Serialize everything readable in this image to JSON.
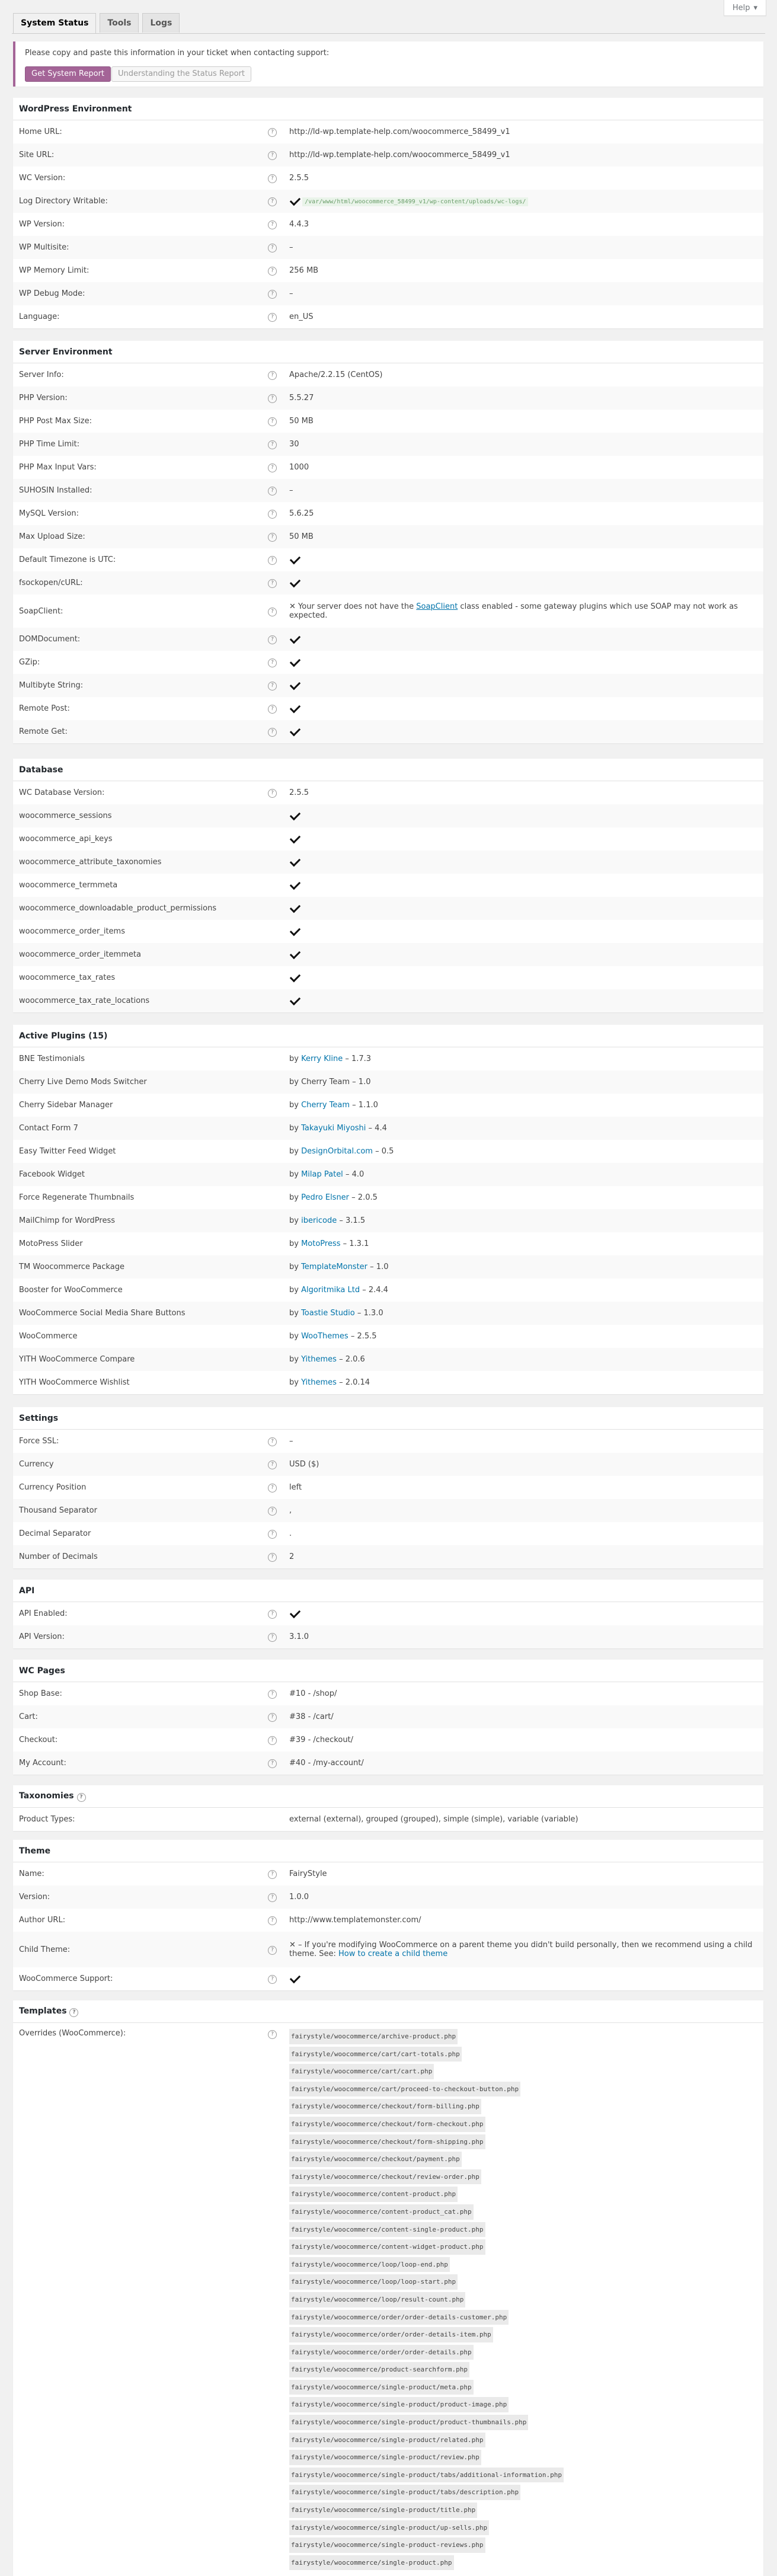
{
  "help_label": "Help",
  "tabs": [
    {
      "label": "System Status"
    },
    {
      "label": "Tools"
    },
    {
      "label": "Logs"
    }
  ],
  "notice": {
    "text": "Please copy and paste this information in your ticket when contacting support:",
    "get_report": "Get System Report",
    "understanding": "Understanding the Status Report"
  },
  "wp_env": {
    "title": "WordPress Environment",
    "rows": [
      {
        "label": "Home URL:",
        "value": "http://ld-wp.template-help.com/woocommerce_58499_v1"
      },
      {
        "label": "Site URL:",
        "value": "http://ld-wp.template-help.com/woocommerce_58499_v1"
      },
      {
        "label": "WC Version:",
        "value": "2.5.5"
      },
      {
        "label": "Log Directory Writable:",
        "value": "/var/www/html/woocommerce_58499_v1/wp-content/uploads/wc-logs/"
      },
      {
        "label": "WP Version:",
        "value": "4.4.3"
      },
      {
        "label": "WP Multisite:",
        "value": "–"
      },
      {
        "label": "WP Memory Limit:",
        "value": "256 MB"
      },
      {
        "label": "WP Debug Mode:",
        "value": "–"
      },
      {
        "label": "Language:",
        "value": "en_US"
      }
    ]
  },
  "server_env": {
    "title": "Server Environment",
    "rows": [
      {
        "label": "Server Info:",
        "value": "Apache/2.2.15 (CentOS)"
      },
      {
        "label": "PHP Version:",
        "value": "5.5.27"
      },
      {
        "label": "PHP Post Max Size:",
        "value": "50 MB"
      },
      {
        "label": "PHP Time Limit:",
        "value": "30"
      },
      {
        "label": "PHP Max Input Vars:",
        "value": "1000"
      },
      {
        "label": "SUHOSIN Installed:",
        "value": "–"
      },
      {
        "label": "MySQL Version:",
        "value": "5.6.25"
      },
      {
        "label": "Max Upload Size:",
        "value": "50 MB"
      },
      {
        "label": "Default Timezone is UTC:",
        "value": ""
      },
      {
        "label": "fsockopen/cURL:",
        "value": ""
      },
      {
        "label": "SoapClient:",
        "value": "✕ Your server does not have the ",
        "link": "SoapClient",
        "value2": " class enabled - some gateway plugins which use SOAP may not work as expected."
      },
      {
        "label": "DOMDocument:",
        "value": ""
      },
      {
        "label": "GZip:",
        "value": ""
      },
      {
        "label": "Multibyte String:",
        "value": ""
      },
      {
        "label": "Remote Post:",
        "value": ""
      },
      {
        "label": "Remote Get:",
        "value": ""
      }
    ]
  },
  "database": {
    "title": "Database",
    "rows": [
      {
        "label": "WC Database Version:",
        "value": "2.5.5"
      },
      {
        "label": "woocommerce_sessions"
      },
      {
        "label": "woocommerce_api_keys"
      },
      {
        "label": "woocommerce_attribute_taxonomies"
      },
      {
        "label": "woocommerce_termmeta"
      },
      {
        "label": "woocommerce_downloadable_product_permissions"
      },
      {
        "label": "woocommerce_order_items"
      },
      {
        "label": "woocommerce_order_itemmeta"
      },
      {
        "label": "woocommerce_tax_rates"
      },
      {
        "label": "woocommerce_tax_rate_locations"
      }
    ]
  },
  "plugins": {
    "title": "Active Plugins (15)",
    "rows": [
      {
        "name": "BNE Testimonials",
        "by": "by ",
        "author": "Kerry Kline",
        "ver": " – 1.7.3",
        "name_link": true,
        "author_link": true
      },
      {
        "name": "Cherry Live Demo Mods Switcher",
        "by": "by Cherry Team – 1.0",
        "author": "",
        "ver": "",
        "name_link": false,
        "author_link": false
      },
      {
        "name": "Cherry Sidebar Manager",
        "by": "by ",
        "author": "Cherry Team",
        "ver": " – 1.1.0",
        "name_link": true,
        "author_link": true
      },
      {
        "name": "Contact Form 7",
        "by": "by ",
        "author": "Takayuki Miyoshi",
        "ver": " – 4.4",
        "name_link": true,
        "author_link": true
      },
      {
        "name": "Easy Twitter Feed Widget",
        "by": "by ",
        "author": "DesignOrbital.com",
        "ver": " – 0.5",
        "name_link": true,
        "author_link": true
      },
      {
        "name": "Facebook Widget",
        "by": "by ",
        "author": "Milap Patel",
        "ver": " – 4.0",
        "name_link": true,
        "author_link": true
      },
      {
        "name": "Force Regenerate Thumbnails",
        "by": "by ",
        "author": "Pedro Elsner",
        "ver": " – 2.0.5",
        "name_link": true,
        "author_link": true
      },
      {
        "name": "MailChimp for WordPress",
        "by": "by ",
        "author": "ibericode",
        "ver": " – 3.1.5",
        "name_link": true,
        "author_link": true
      },
      {
        "name": "MotoPress Slider",
        "by": "by ",
        "author": "MotoPress",
        "ver": " – 1.3.1",
        "name_link": true,
        "author_link": true
      },
      {
        "name": "TM Woocommerce Package",
        "by": "by ",
        "author": "TemplateMonster",
        "ver": " – 1.0",
        "name_link": false,
        "author_link": true
      },
      {
        "name": "Booster for WooCommerce",
        "by": "by ",
        "author": "Algoritmika Ltd",
        "ver": " – 2.4.4",
        "name_link": true,
        "author_link": true
      },
      {
        "name": "WooCommerce Social Media Share Buttons",
        "by": "by ",
        "author": "Toastie Studio",
        "ver": " – 1.3.0",
        "name_link": true,
        "author_link": true
      },
      {
        "name": "WooCommerce",
        "by": "by ",
        "author": "WooThemes",
        "ver": " – 2.5.5",
        "name_link": true,
        "author_link": true
      },
      {
        "name": "YITH WooCommerce Compare",
        "by": "by ",
        "author": "Yithemes",
        "ver": " – 2.0.6",
        "name_link": true,
        "author_link": true
      },
      {
        "name": "YITH WooCommerce Wishlist",
        "by": "by ",
        "author": "Yithemes",
        "ver": " – 2.0.14",
        "name_link": true,
        "author_link": true
      }
    ]
  },
  "settings": {
    "title": "Settings",
    "rows": [
      {
        "label": "Force SSL:",
        "value": "–"
      },
      {
        "label": "Currency",
        "value": "USD ($)"
      },
      {
        "label": "Currency Position",
        "value": "left"
      },
      {
        "label": "Thousand Separator",
        "value": ","
      },
      {
        "label": "Decimal Separator",
        "value": "."
      },
      {
        "label": "Number of Decimals",
        "value": "2"
      }
    ]
  },
  "api": {
    "title": "API",
    "rows": [
      {
        "label": "API Enabled:",
        "value": ""
      },
      {
        "label": "API Version:",
        "value": "3.1.0"
      }
    ]
  },
  "wc_pages": {
    "title": "WC Pages",
    "rows": [
      {
        "label": "Shop Base:",
        "value": "#10 - /shop/"
      },
      {
        "label": "Cart:",
        "value": "#38 - /cart/"
      },
      {
        "label": "Checkout:",
        "value": "#39 - /checkout/"
      },
      {
        "label": "My Account:",
        "value": "#40 - /my-account/"
      }
    ]
  },
  "taxonomies": {
    "title": "Taxonomies",
    "rows": [
      {
        "label": "Product Types:",
        "value": "external (external), grouped (grouped), simple (simple), variable (variable)"
      }
    ]
  },
  "theme": {
    "title": "Theme",
    "rows": [
      {
        "label": "Name:",
        "value": "FairyStyle"
      },
      {
        "label": "Version:",
        "value": "1.0.0"
      },
      {
        "label": "Author URL:",
        "value": "http://www.templatemonster.com/"
      },
      {
        "label": "Child Theme:",
        "value": "✕ – If you're modifying WooCommerce on a parent theme you didn't build personally, then we recommend using a child theme. See: ",
        "link": "How to create a child theme"
      },
      {
        "label": "WooCommerce Support:",
        "value": ""
      }
    ]
  },
  "templates": {
    "title": "Templates",
    "label": "Overrides (WooCommerce):",
    "files": [
      "fairystyle/woocommerce/archive-product.php",
      "fairystyle/woocommerce/cart/cart-totals.php",
      "fairystyle/woocommerce/cart/cart.php",
      "fairystyle/woocommerce/cart/proceed-to-checkout-button.php",
      "fairystyle/woocommerce/checkout/form-billing.php",
      "fairystyle/woocommerce/checkout/form-checkout.php",
      "fairystyle/woocommerce/checkout/form-shipping.php",
      "fairystyle/woocommerce/checkout/payment.php",
      "fairystyle/woocommerce/checkout/review-order.php",
      "fairystyle/woocommerce/content-product.php",
      "fairystyle/woocommerce/content-product_cat.php",
      "fairystyle/woocommerce/content-single-product.php",
      "fairystyle/woocommerce/content-widget-product.php",
      "fairystyle/woocommerce/loop/loop-end.php",
      "fairystyle/woocommerce/loop/loop-start.php",
      "fairystyle/woocommerce/loop/result-count.php",
      "fairystyle/woocommerce/order/order-details-customer.php",
      "fairystyle/woocommerce/order/order-details-item.php",
      "fairystyle/woocommerce/order/order-details.php",
      "fairystyle/woocommerce/product-searchform.php",
      "fairystyle/woocommerce/single-product/meta.php",
      "fairystyle/woocommerce/single-product/product-image.php",
      "fairystyle/woocommerce/single-product/product-thumbnails.php",
      "fairystyle/woocommerce/single-product/related.php",
      "fairystyle/woocommerce/single-product/review.php",
      "fairystyle/woocommerce/single-product/tabs/additional-information.php",
      "fairystyle/woocommerce/single-product/tabs/description.php",
      "fairystyle/woocommerce/single-product/title.php",
      "fairystyle/woocommerce/single-product/up-sells.php",
      "fairystyle/woocommerce/single-product-reviews.php",
      "fairystyle/woocommerce/single-product.php"
    ]
  }
}
